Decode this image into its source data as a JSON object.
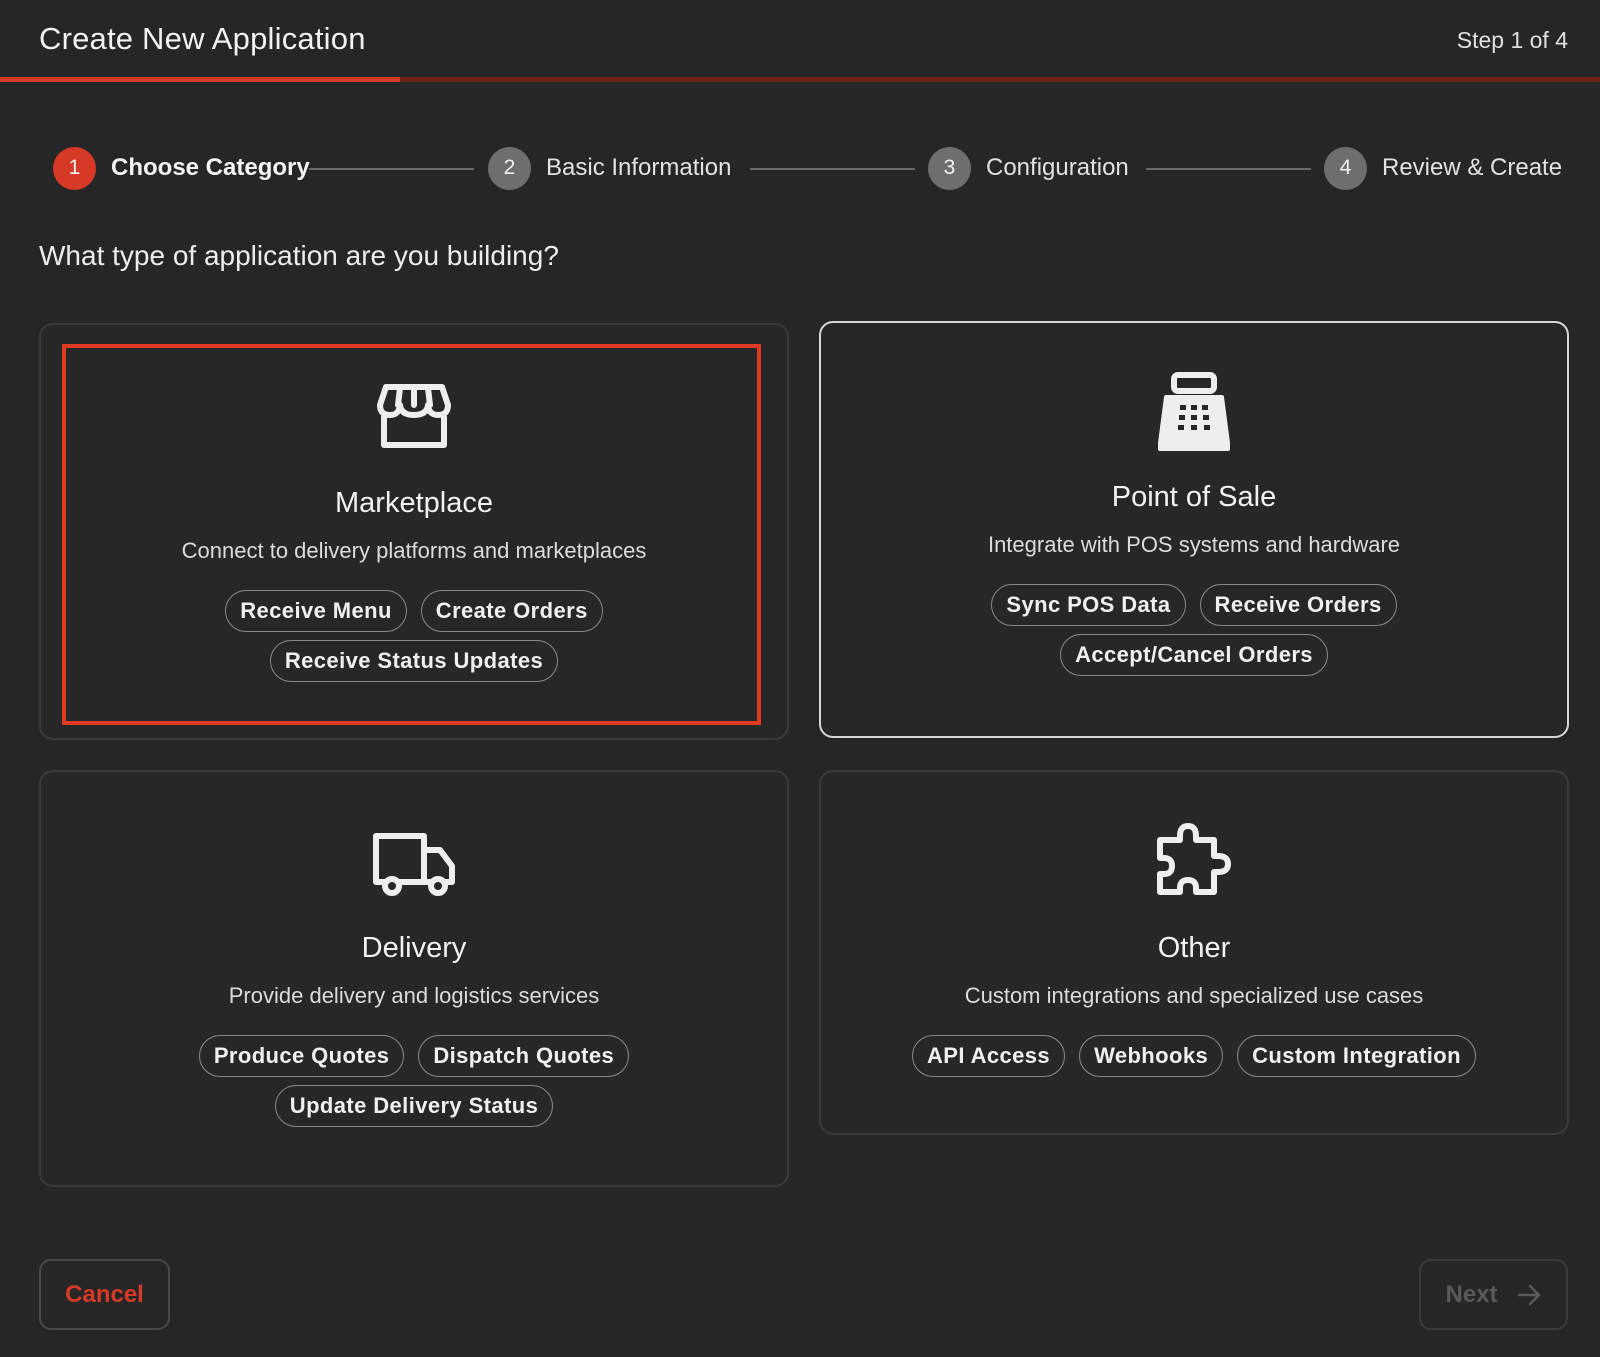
{
  "header": {
    "title": "Create New Application",
    "step_indicator": "Step 1 of 4",
    "progress_fraction": 0.25
  },
  "stepper": {
    "steps": [
      {
        "number": "1",
        "label": "Choose Category",
        "active": true
      },
      {
        "number": "2",
        "label": "Basic Information",
        "active": false
      },
      {
        "number": "3",
        "label": "Configuration",
        "active": false
      },
      {
        "number": "4",
        "label": "Review & Create",
        "active": false
      }
    ]
  },
  "question": "What type of application are you building?",
  "categories": [
    {
      "icon": "storefront-icon",
      "title": "Marketplace",
      "description": "Connect to delivery platforms and marketplaces",
      "tags": [
        "Receive Menu",
        "Create Orders",
        "Receive Status Updates"
      ]
    },
    {
      "icon": "cash-register-icon",
      "title": "Point of Sale",
      "description": "Integrate with POS systems and hardware",
      "tags": [
        "Sync POS Data",
        "Receive Orders",
        "Accept/Cancel Orders"
      ]
    },
    {
      "icon": "truck-icon",
      "title": "Delivery",
      "description": "Provide delivery and logistics services",
      "tags": [
        "Produce Quotes",
        "Dispatch Quotes",
        "Update Delivery Status"
      ]
    },
    {
      "icon": "puzzle-piece-icon",
      "title": "Other",
      "description": "Custom integrations and specialized use cases",
      "tags": [
        "API Access",
        "Webhooks",
        "Custom Integration"
      ]
    }
  ],
  "footer": {
    "cancel_label": "Cancel",
    "next_label": "Next",
    "next_icon": "arrow-right-icon"
  },
  "colors": {
    "accent": "#d63a26",
    "background": "#262626",
    "selection_outline": "#e03a22"
  }
}
